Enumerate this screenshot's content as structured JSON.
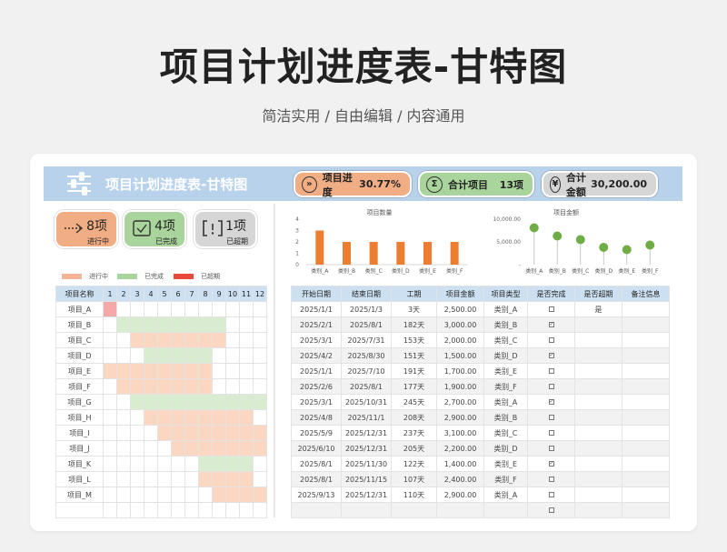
{
  "hero": {
    "title": "项目计划进度表-甘特图",
    "subtitle": "简洁实用 / 自由编辑 / 内容通用"
  },
  "header": {
    "title": "项目计划进度表-甘特图",
    "kpis": [
      {
        "label": "项目进度",
        "value": "30.77%",
        "icon": "progress-icon"
      },
      {
        "label": "合计项目",
        "value": "13项",
        "icon": "sum-icon"
      },
      {
        "label": "合计金额",
        "value": "30,200.00",
        "icon": "yen-icon"
      }
    ]
  },
  "badges": [
    {
      "count": "8项",
      "label": "进行中",
      "icon": "arrow-icon"
    },
    {
      "count": "4项",
      "label": "已完成",
      "icon": "check-icon"
    },
    {
      "count": "1项",
      "label": "已超期",
      "icon": "alert-icon"
    }
  ],
  "legend": [
    {
      "label": "进行中",
      "color": "#f4b497"
    },
    {
      "label": "已完成",
      "color": "#a9d49b"
    },
    {
      "label": "已超期",
      "color": "#e84a3c"
    }
  ],
  "gantt": {
    "name_header": "项目名称",
    "months": [
      "1",
      "2",
      "3",
      "4",
      "5",
      "6",
      "7",
      "8",
      "9",
      "10",
      "11",
      "12"
    ],
    "rows": [
      {
        "name": "项目_A",
        "cells": "o..........."
      },
      {
        "name": "项目_B",
        "cells": ".cccccccc..."
      },
      {
        "name": "项目_C",
        "cells": "..ppppppp..."
      },
      {
        "name": "项目_D",
        "cells": "...ccccc...."
      },
      {
        "name": "项目_E",
        "cells": "pppppppp...."
      },
      {
        "name": "项目_F",
        "cells": ".ppppppp...."
      },
      {
        "name": "项目_G",
        "cells": "..cccccccccc"
      },
      {
        "name": "项目_H",
        "cells": "...pppppppp."
      },
      {
        "name": "项目_I",
        "cells": "....pppppppp"
      },
      {
        "name": "项目_J",
        "cells": ".....ppppppp"
      },
      {
        "name": "项目_K",
        "cells": ".......cccc."
      },
      {
        "name": "项目_L",
        "cells": ".......pppp."
      },
      {
        "name": "项目_M",
        "cells": "........pppp"
      },
      {
        "name": "",
        "cells": "............"
      }
    ]
  },
  "chart_data": [
    {
      "type": "bar",
      "title": "项目数量",
      "categories": [
        "类别_A",
        "类别_B",
        "类别_C",
        "类别_D",
        "类别_E",
        "类别_F"
      ],
      "values": [
        3,
        2,
        2,
        2,
        2,
        2
      ],
      "ylim": [
        0,
        4
      ],
      "yticks": [
        "0",
        "1",
        "2",
        "3",
        "4"
      ],
      "color": "#ed7d31"
    },
    {
      "type": "scatter",
      "title": "项目金额",
      "categories": [
        "类别_A",
        "类别_B",
        "类别_C",
        "类别_D",
        "类别_E",
        "类别_F"
      ],
      "values": [
        8100,
        6300,
        5500,
        3800,
        3300,
        4300
      ],
      "ylim": [
        0,
        10000
      ],
      "yticks": [
        "-",
        "5,000.00",
        "10,000.00"
      ],
      "color": "#70ad47"
    }
  ],
  "table": {
    "headers": [
      "开始日期",
      "结束日期",
      "工期",
      "项目金额",
      "项目类型",
      "是否完成",
      "是否超期",
      "备注信息"
    ],
    "rows": [
      [
        "2025/1/1",
        "2025/1/3",
        "3天",
        "2,500.00",
        "类别_A",
        "0",
        "是",
        ""
      ],
      [
        "2025/2/1",
        "2025/8/1",
        "182天",
        "3,000.00",
        "类别_B",
        "1",
        "",
        ""
      ],
      [
        "2025/3/1",
        "2025/7/31",
        "153天",
        "2,000.00",
        "类别_C",
        "0",
        "",
        ""
      ],
      [
        "2025/4/2",
        "2025/8/30",
        "151天",
        "1,500.00",
        "类别_D",
        "1",
        "",
        ""
      ],
      [
        "2025/1/1",
        "2025/7/10",
        "191天",
        "1,700.00",
        "类别_E",
        "0",
        "",
        ""
      ],
      [
        "2025/2/6",
        "2025/8/1",
        "177天",
        "1,900.00",
        "类别_F",
        "0",
        "",
        ""
      ],
      [
        "2025/3/1",
        "2025/10/31",
        "245天",
        "2,700.00",
        "类别_A",
        "1",
        "",
        ""
      ],
      [
        "2025/4/8",
        "2025/11/1",
        "208天",
        "2,900.00",
        "类别_B",
        "0",
        "",
        ""
      ],
      [
        "2025/5/9",
        "2025/12/31",
        "237天",
        "3,100.00",
        "类别_C",
        "0",
        "",
        ""
      ],
      [
        "2025/6/10",
        "2025/12/31",
        "205天",
        "2,200.00",
        "类别_D",
        "0",
        "",
        ""
      ],
      [
        "2025/8/1",
        "2025/11/30",
        "122天",
        "1,400.00",
        "类别_E",
        "1",
        "",
        ""
      ],
      [
        "2025/8/1",
        "2025/11/15",
        "107天",
        "2,400.00",
        "类别_F",
        "0",
        "",
        ""
      ],
      [
        "2025/9/13",
        "2025/12/31",
        "110天",
        "2,900.00",
        "类别_A",
        "0",
        "",
        ""
      ],
      [
        "",
        "",
        "",
        "",
        "",
        "0",
        "",
        ""
      ]
    ]
  }
}
